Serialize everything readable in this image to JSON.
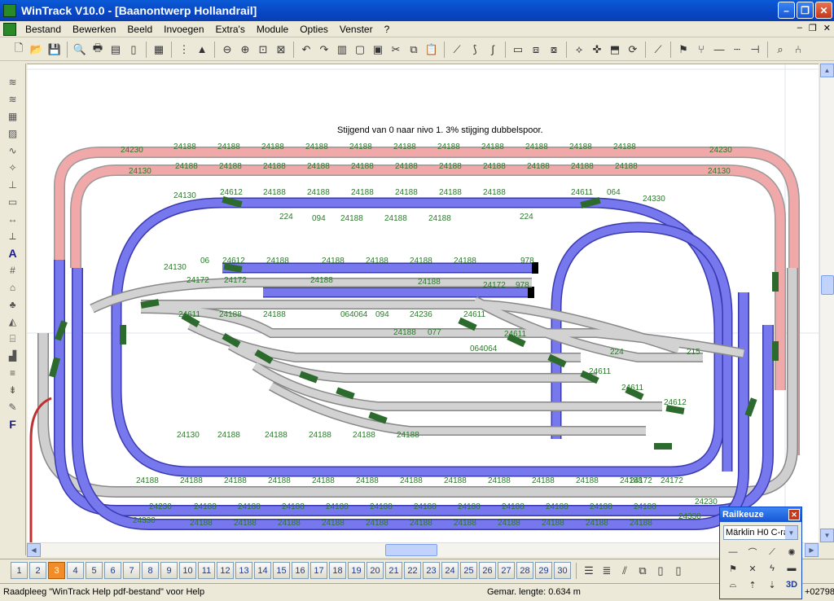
{
  "window": {
    "title": "WinTrack  V10.0 - [Baanontwerp Hollandrail]"
  },
  "menu": [
    "Bestand",
    "Bewerken",
    "Beeld",
    "Invoegen",
    "Extra's",
    "Module",
    "Opties",
    "Venster",
    "?"
  ],
  "canvas": {
    "heading": "Stijgend van 0 naar nivo 1.   3% stijging dubbelspoor.",
    "track_labels_top": [
      "24230",
      "24188",
      "24188",
      "24188",
      "24188",
      "24188",
      "24188",
      "24188",
      "24188",
      "24188",
      "24188",
      "24188",
      "24230"
    ],
    "track_labels_row2": [
      "24130",
      "24188",
      "24188",
      "24188",
      "24188",
      "24188",
      "24188",
      "24188",
      "24188",
      "24188",
      "24188",
      "24188",
      "24130"
    ],
    "track_labels_row3": [
      "24130",
      "24612",
      "24188",
      "24188",
      "24188",
      "24188",
      "24188",
      "24188",
      "24611",
      "064",
      "24330"
    ],
    "track_labels_mid": [
      "224",
      "094",
      "24188",
      "24188",
      "24188",
      "224"
    ],
    "track_labels_stub": [
      "24130",
      "06",
      "24612",
      "24188",
      "24188",
      "24188",
      "24188",
      "24188",
      "978"
    ],
    "track_labels_stub2": [
      "24172",
      "24172",
      "24188",
      "24188",
      "24172",
      "978"
    ],
    "track_labels_bottom": [
      "24188",
      "24188",
      "24188",
      "24188",
      "24188",
      "24188",
      "24188",
      "24188",
      "24188",
      "24188",
      "24188",
      "24188",
      "24172",
      "24172"
    ],
    "track_labels_bottom2": [
      "24230",
      "24188",
      "24188",
      "24188",
      "24188",
      "24188",
      "24188",
      "24188",
      "24188",
      "24188",
      "24188",
      "24188",
      "24230"
    ],
    "track_labels_bottom3": [
      "24330",
      "24188",
      "24188",
      "24188",
      "24188",
      "24188",
      "24188",
      "24188",
      "24188",
      "24188",
      "24188",
      "24188",
      "24330"
    ],
    "track_labels_inner": [
      "24130",
      "24188",
      "24188",
      "24188",
      "24188",
      "24188"
    ],
    "track_labels_yard": [
      "24611",
      "24188",
      "24188",
      "064064",
      "094",
      "24236",
      "24611",
      "24611",
      "24611",
      "24611",
      "24612",
      "077",
      "064064",
      "24188",
      "224",
      "215"
    ]
  },
  "layers": {
    "buttons": [
      "1",
      "2",
      "3",
      "4",
      "5",
      "6",
      "7",
      "8",
      "9",
      "10",
      "11",
      "12",
      "13",
      "14",
      "15",
      "16",
      "17",
      "18",
      "19",
      "20",
      "21",
      "22",
      "23",
      "24",
      "25",
      "26",
      "27",
      "28",
      "29",
      "30"
    ],
    "active": "3"
  },
  "status": {
    "help": "Raadpleeg \"WinTrack Help pdf-bestand\" voor Help",
    "length": "Gemar. lengte:  0.634 m",
    "coord": "+02798"
  },
  "rail_panel": {
    "title": "Railkeuze",
    "selection": "Märklin H0 C-ra",
    "tools": [
      "straight-icon",
      "curve-icon",
      "switch-icon",
      "turntable-icon",
      "signal-icon",
      "crossing-icon",
      "bridge-icon",
      "buffer-icon",
      "tunnel-icon",
      "up-icon",
      "down-icon",
      "3D"
    ]
  },
  "colors": {
    "blue_track": "#6666ee",
    "red_track": "#e8a0a0",
    "grey_track": "#c8c8c8",
    "green_switch": "#2d6a2d",
    "label_green": "#2a7a2a"
  }
}
